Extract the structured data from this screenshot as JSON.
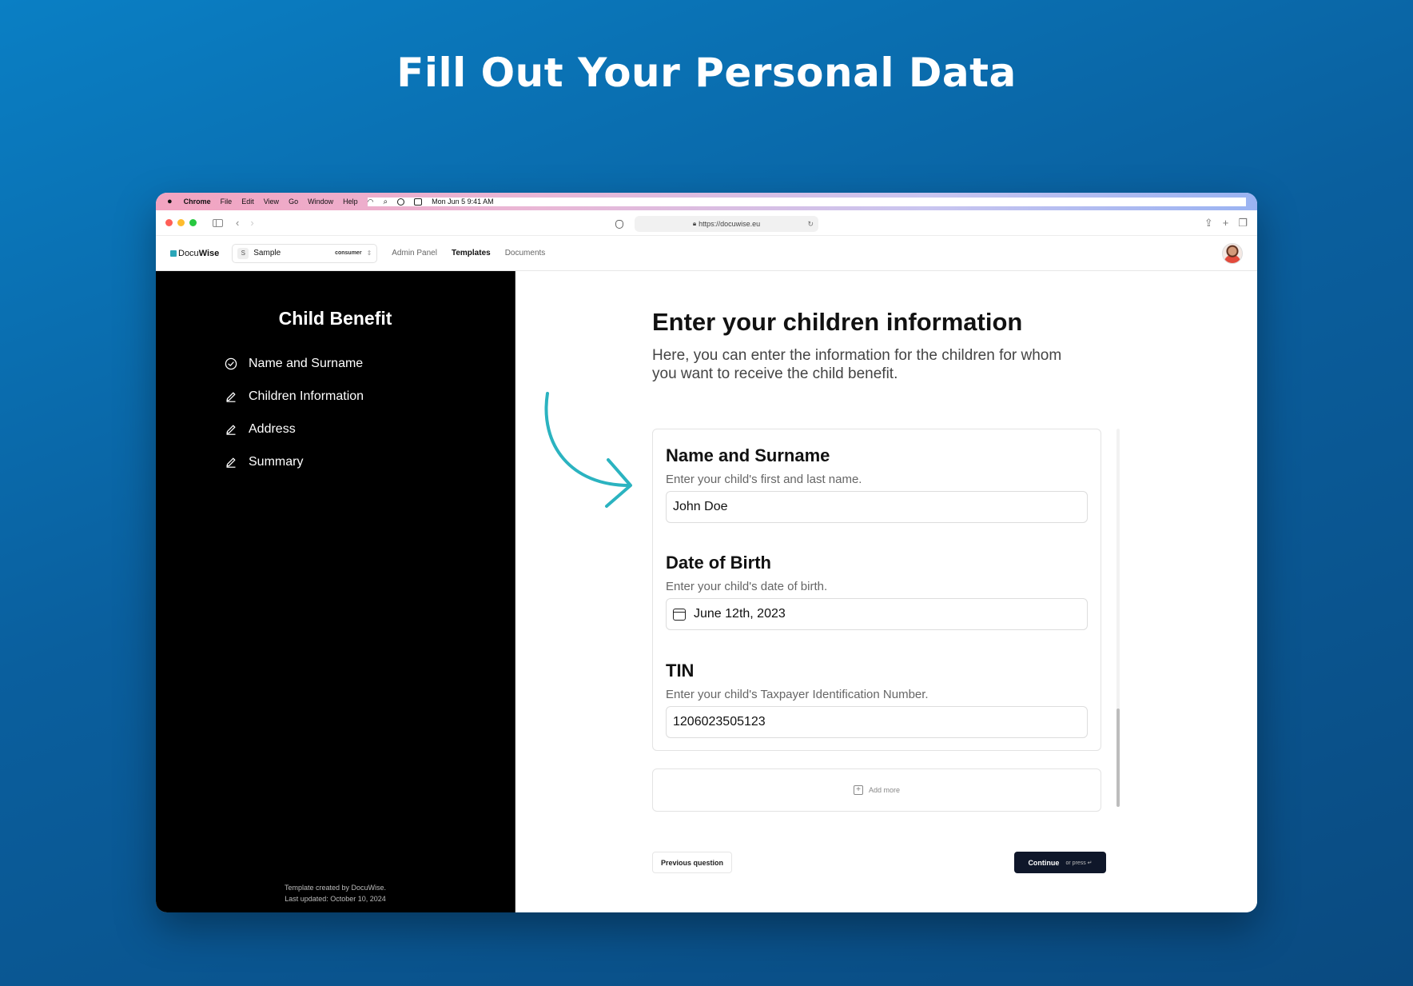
{
  "hero": {
    "title": "Fill Out Your Personal Data"
  },
  "menubar": {
    "app": "Chrome",
    "items": [
      "File",
      "Edit",
      "View",
      "Go",
      "Window",
      "Help"
    ],
    "clock": "Mon Jun 5  9:41 AM"
  },
  "browser": {
    "url": "https://docuwise.eu"
  },
  "appbar": {
    "logo_light": "Docu",
    "logo_bold": "Wise",
    "workspace_initial": "S",
    "workspace_name": "Sample",
    "workspace_badge": "consumer",
    "nav": {
      "admin": "Admin Panel",
      "templates": "Templates",
      "documents": "Documents"
    }
  },
  "sidebar": {
    "title": "Child Benefit",
    "steps": [
      {
        "label": "Name and Surname",
        "icon": "check-circle-icon"
      },
      {
        "label": "Children Information",
        "icon": "pencil-icon"
      },
      {
        "label": "Address",
        "icon": "pencil-icon"
      },
      {
        "label": "Summary",
        "icon": "pencil-icon"
      }
    ],
    "footer_line1": "Template created by DocuWise.",
    "footer_line2": "Last updated: October 10, 2024"
  },
  "question": {
    "title": "Enter your children information",
    "description": "Here, you can enter the information for the children for whom you want to receive the child benefit."
  },
  "form": {
    "name": {
      "label": "Name and Surname",
      "help": "Enter your child's first and last name.",
      "value": "John Doe"
    },
    "dob": {
      "label": "Date of Birth",
      "help": "Enter your child's date of birth.",
      "value": "June 12th, 2023"
    },
    "tin": {
      "label": "TIN",
      "help": "Enter your child's Taxpayer Identification Number.",
      "value": "1206023505123"
    },
    "add_more": "Add more"
  },
  "actions": {
    "previous": "Previous question",
    "continue": "Continue",
    "continue_hint": "or press ↵"
  },
  "colors": {
    "arrow": "#2bb3c0",
    "continue_bg": "#0f172a"
  }
}
